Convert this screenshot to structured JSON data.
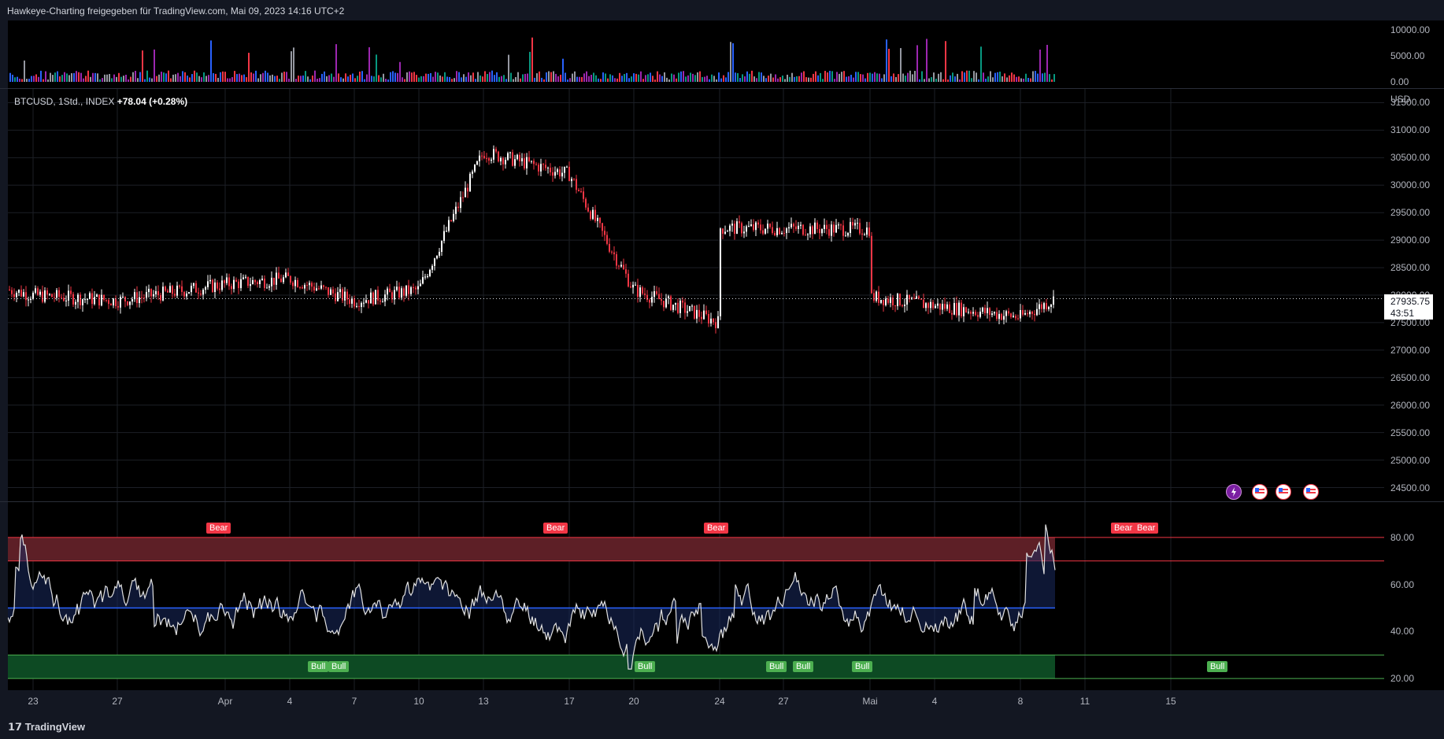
{
  "header": {
    "title": "Hawkeye-Charting freigegeben für TradingView.com, Mai 09, 2023 14:16 UTC+2"
  },
  "legend": {
    "symbol": "BTCUSD, 1Std., INDEX",
    "change": "+78.04 (+0.28%)"
  },
  "price_axis": {
    "currency": "USD",
    "last_price": "27935.75",
    "countdown": "43:51"
  },
  "footer": {
    "brand": "TradingView"
  },
  "events": [
    "lightning-icon",
    "us-flag-icon",
    "us-flag-icon",
    "us-flag-icon"
  ],
  "chart_data": [
    {
      "type": "bar",
      "title": "",
      "ylim": [
        0,
        10000
      ],
      "yticks": [
        "10000.00",
        "5000.00",
        "0.00"
      ]
    },
    {
      "type": "line",
      "series": [
        {
          "name": "",
          "x": [
            "23",
            "27",
            "Apr",
            "4",
            "7",
            "10",
            "13",
            "17",
            "20",
            "24",
            "27",
            "Mai",
            "4",
            "8"
          ],
          "values": [
            28000,
            27900,
            28200,
            28300,
            27900,
            28100,
            30600,
            30200,
            28100,
            27500,
            29300,
            29200,
            29400,
            27600
          ]
        }
      ],
      "xticks": [
        "23",
        "27",
        "Apr",
        "4",
        "7",
        "10",
        "13",
        "17",
        "20",
        "24",
        "27",
        "Mai",
        "4",
        "8",
        "11",
        "15"
      ],
      "yticks": [
        "31500.00",
        "31000.00",
        "30500.00",
        "30000.00",
        "29500.00",
        "29000.00",
        "28500.00",
        "28000.00",
        "27500.00",
        "27000.00",
        "26500.00",
        "26000.00",
        "25500.00",
        "25000.00",
        "24500.00"
      ],
      "ylim": [
        24250,
        31750
      ],
      "last": 27935.75
    },
    {
      "type": "line",
      "ylim": [
        15,
        95
      ],
      "yticks": [
        "80.00",
        "60.00",
        "40.00",
        "20.00"
      ],
      "bands": {
        "upper": [
          70,
          80
        ],
        "mid": 50,
        "lower": [
          20,
          30
        ]
      },
      "signals": {
        "bear": [
          "Bear",
          "Bear",
          "Bear",
          "Bear",
          "Bear"
        ],
        "bull": [
          "Bull",
          "Bull",
          "Bull",
          "Bull",
          "Bull",
          "Bull",
          "Bull"
        ]
      }
    }
  ]
}
